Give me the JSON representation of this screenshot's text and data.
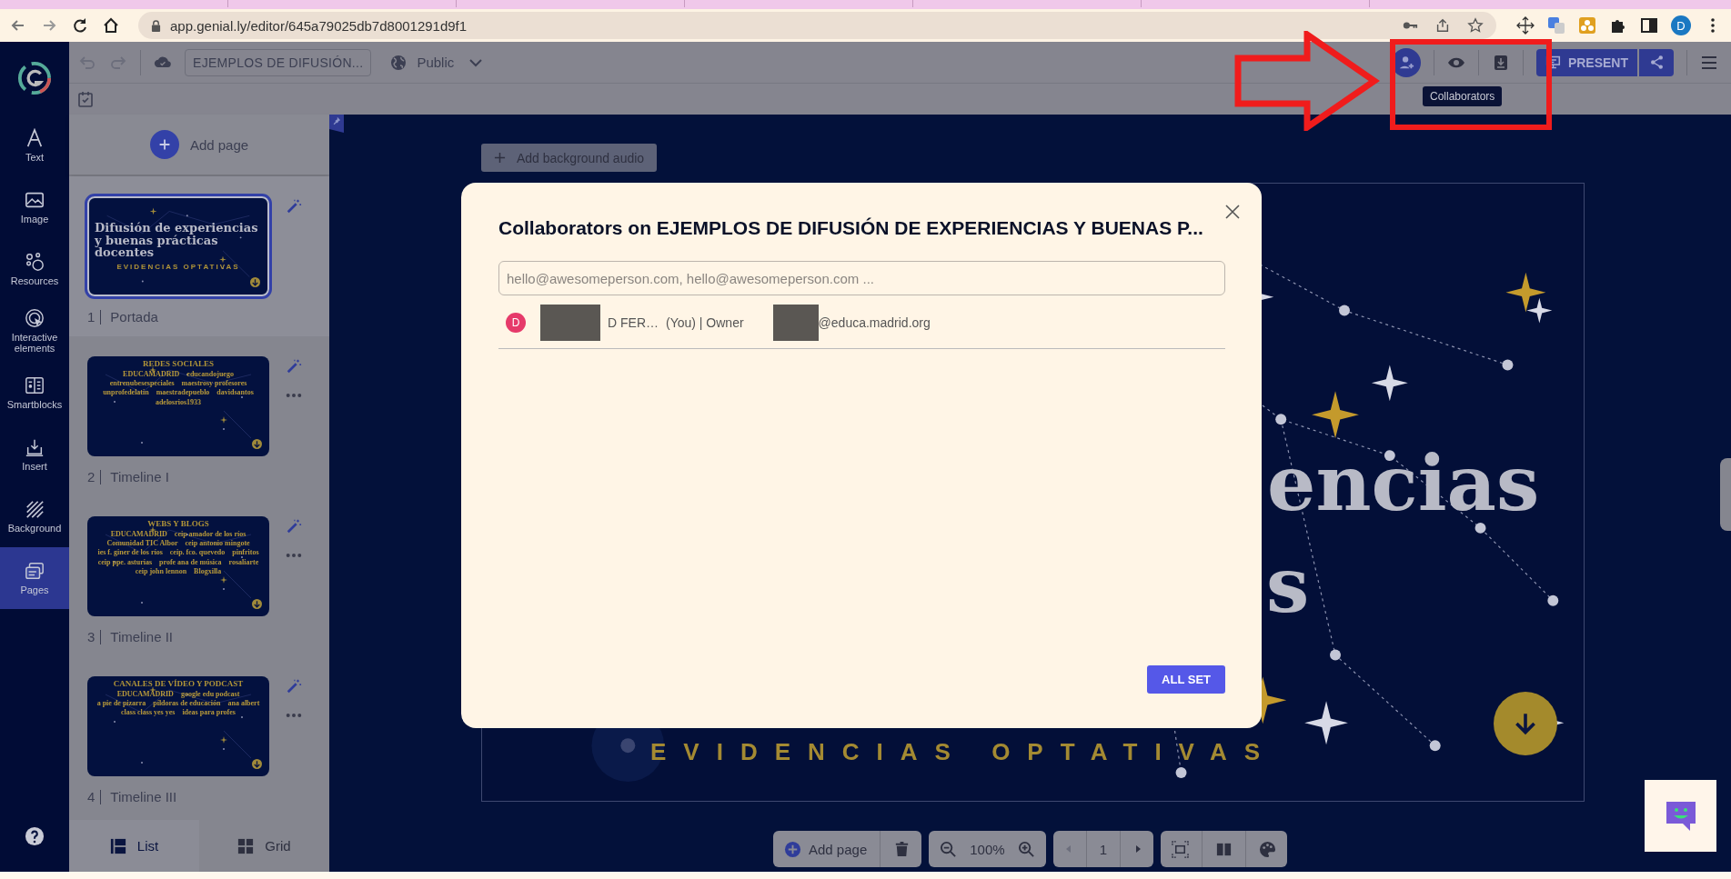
{
  "browser": {
    "url": "app.genial.ly/editor/645a79025db7d8001291d9f1",
    "profile_initial": "D"
  },
  "toolbar": {
    "title": "EJEMPLOS DE DIFUSIÓN...",
    "visibility": "Public",
    "tooltip": "Collaborators",
    "present": "PRESENT"
  },
  "sidebar": {
    "items": [
      {
        "label": "Text",
        "kind": "text",
        "selected": false
      },
      {
        "label": "Image",
        "kind": "image",
        "selected": false
      },
      {
        "label": "Resources",
        "kind": "resources",
        "selected": false
      },
      {
        "label": "Interactive elements",
        "kind": "interactive",
        "selected": false
      },
      {
        "label": "Smartblocks",
        "kind": "smartblocks",
        "selected": false
      },
      {
        "label": "Insert",
        "kind": "insert",
        "selected": false
      },
      {
        "label": "Background",
        "kind": "background",
        "selected": false
      },
      {
        "label": "Pages",
        "kind": "pages",
        "selected": true
      }
    ]
  },
  "pages_panel": {
    "add_label": "Add page",
    "pages": [
      {
        "number": "1",
        "name": "Portada",
        "selected": true,
        "thumbnail": {
          "kind": "cover",
          "title": "Difusión de experiencias y buenas prácticas docentes",
          "subtitle": "EVIDENCIAS OPTATIVAS"
        }
      },
      {
        "number": "2",
        "name": "Timeline I",
        "selected": false,
        "thumbnail": {
          "kind": "timeline",
          "title": "REDES SOCIALES",
          "labels": [
            "EDUCAMADRID",
            "educandojuego",
            "entrenubesespeciales",
            "maestrosy profesores",
            "unprofedelatin",
            "maestradepueblo",
            "davidsantos",
            "adelosrios1933"
          ]
        }
      },
      {
        "number": "3",
        "name": "Timeline II",
        "selected": false,
        "thumbnail": {
          "kind": "timeline",
          "title": "WEBS Y BLOGS",
          "labels": [
            "EDUCAMADRID",
            "ceip amador de los ríos",
            "Comunidad TIC Albor",
            "ceip antonio mingote",
            "ies f. giner de los ríos",
            "ceip. fco. quevedo",
            "pinfritos",
            "ceip ppe. asturias",
            "profe ana de música",
            "rosaliarte",
            "ceip john lennon",
            "Blogxilla"
          ]
        }
      },
      {
        "number": "4",
        "name": "Timeline III",
        "selected": false,
        "thumbnail": {
          "kind": "timeline",
          "title": "CANALES DE VÍDEO Y PODCAST",
          "labels": [
            "EDUCAMADRID",
            "google edu podcast",
            "a pie de pizarra",
            "píldoras de educación",
            "ana albert",
            "class class yes yes",
            "ideas para profes"
          ]
        }
      }
    ],
    "view_tabs": [
      {
        "label": "List",
        "kind": "list",
        "selected": true
      },
      {
        "label": "Grid",
        "kind": "grid",
        "selected": false
      }
    ]
  },
  "canvas": {
    "audio_button": "Add background audio",
    "slide": {
      "title_fragments": [
        "encias",
        "s"
      ],
      "subtitle": "EVIDENCIAS OPTATIVAS"
    }
  },
  "bottom_toolbar": {
    "add_page": "Add page",
    "zoom": "100%",
    "page": "1"
  },
  "modal": {
    "title": "Collaborators on EJEMPLOS DE DIFUSIÓN DE EXPERIENCIAS Y BUENAS P...",
    "placeholder": "hello@awesomeperson.com, hello@awesomeperson.com ...",
    "collaborators": [
      {
        "initial": "D",
        "name": "D FER…",
        "role": "(You) | Owner",
        "email": "@educa.madrid.org"
      }
    ],
    "confirm": "ALL SET"
  }
}
